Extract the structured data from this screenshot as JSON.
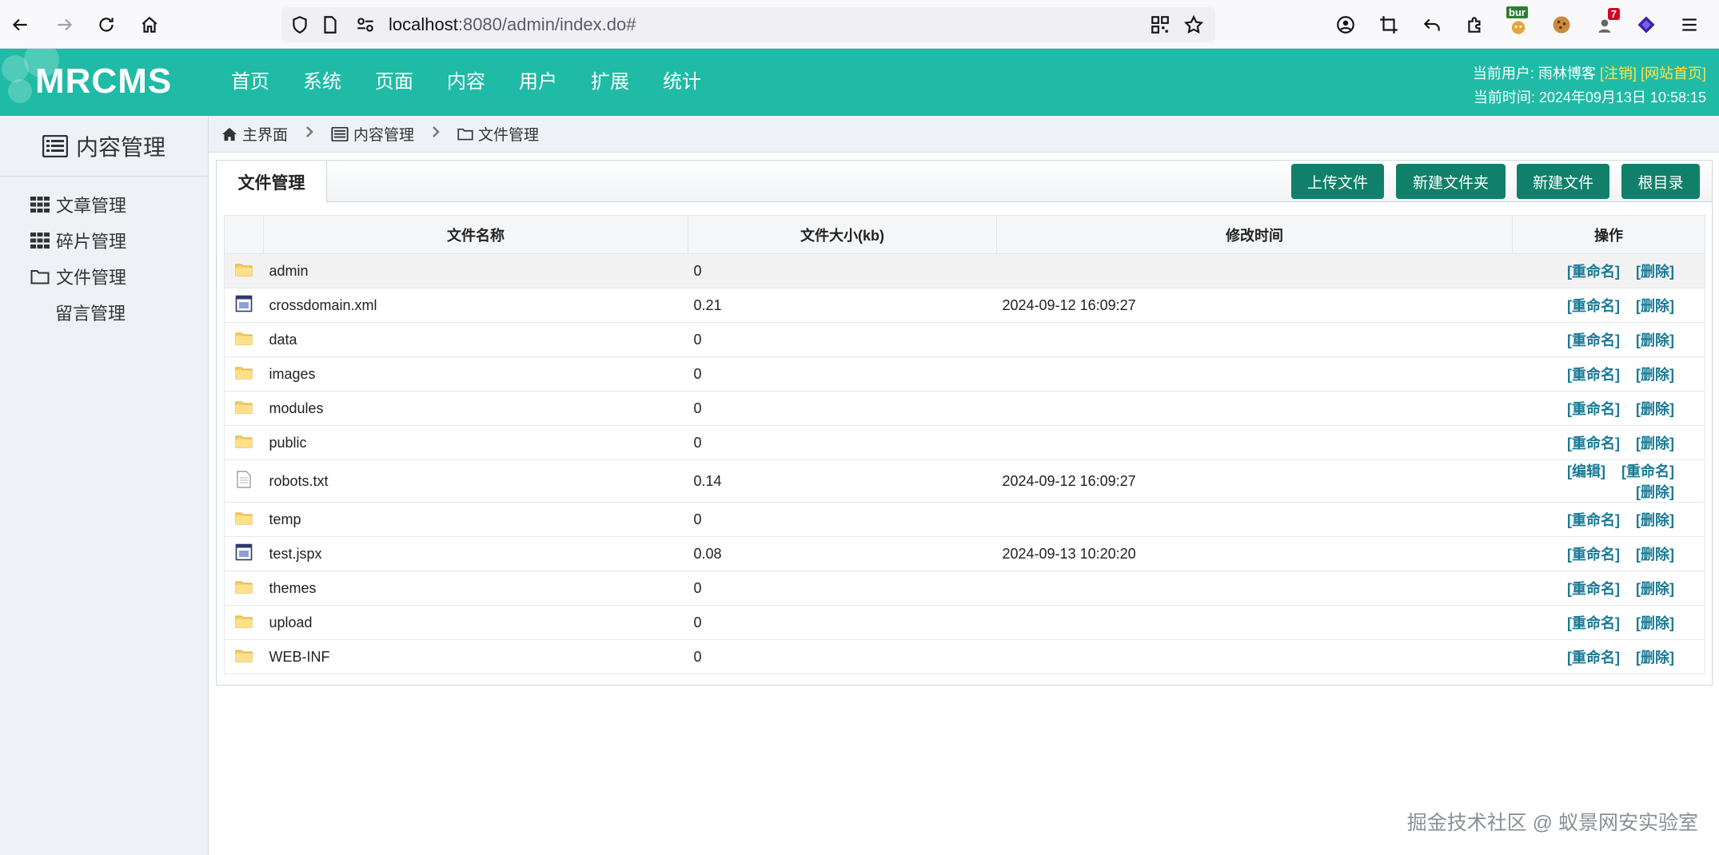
{
  "browser": {
    "url_host": "localhost",
    "url_rest": ":8080/admin/index.do#",
    "notification_count": "7",
    "extension_label": "bur"
  },
  "header": {
    "logo": "MRCMS",
    "nav": [
      "首页",
      "系统",
      "页面",
      "内容",
      "用户",
      "扩展",
      "统计"
    ],
    "user_label": "当前用户: 雨林博客",
    "logout": "[注销]",
    "site_home": "[网站首页]",
    "time_text": "当前时间: 2024年09月13日 10:58:15"
  },
  "sidebar": {
    "title": "内容管理",
    "items": [
      {
        "label": "文章管理",
        "icon": "grid-icon"
      },
      {
        "label": "碎片管理",
        "icon": "grid-icon"
      },
      {
        "label": "文件管理",
        "icon": "folder-outline-icon"
      },
      {
        "label": "留言管理",
        "icon": ""
      }
    ]
  },
  "breadcrumb": {
    "home": "主界面",
    "section": "内容管理",
    "current": "文件管理"
  },
  "panel": {
    "tab": "文件管理",
    "buttons": {
      "upload": "上传文件",
      "new_folder": "新建文件夹",
      "new_file": "新建文件",
      "root": "根目录"
    },
    "columns": {
      "name": "文件名称",
      "size": "文件大小(kb)",
      "modified": "修改时间",
      "ops": "操作"
    },
    "ops": {
      "edit": "[编辑]",
      "rename": "[重命名]",
      "delete": "[删除]"
    },
    "rows": [
      {
        "name": "admin",
        "size": "0",
        "modified": "",
        "type": "folder"
      },
      {
        "name": "crossdomain.xml",
        "size": "0.21",
        "modified": "2024-09-12 16:09:27",
        "type": "code"
      },
      {
        "name": "data",
        "size": "0",
        "modified": "",
        "type": "folder"
      },
      {
        "name": "images",
        "size": "0",
        "modified": "",
        "type": "folder"
      },
      {
        "name": "modules",
        "size": "0",
        "modified": "",
        "type": "folder"
      },
      {
        "name": "public",
        "size": "0",
        "modified": "",
        "type": "folder"
      },
      {
        "name": "robots.txt",
        "size": "0.14",
        "modified": "2024-09-12 16:09:27",
        "type": "text"
      },
      {
        "name": "temp",
        "size": "0",
        "modified": "",
        "type": "folder"
      },
      {
        "name": "test.jspx",
        "size": "0.08",
        "modified": "2024-09-13 10:20:20",
        "type": "code"
      },
      {
        "name": "themes",
        "size": "0",
        "modified": "",
        "type": "folder"
      },
      {
        "name": "upload",
        "size": "0",
        "modified": "",
        "type": "folder"
      },
      {
        "name": "WEB-INF",
        "size": "0",
        "modified": "",
        "type": "folder"
      }
    ]
  },
  "watermark": "掘金技术社区 @ 蚁景网安实验室",
  "colors": {
    "header_bg": "#1fbba6",
    "button_bg": "#11806a",
    "link": "#1a7a96",
    "highlight": "#ffe34d"
  }
}
